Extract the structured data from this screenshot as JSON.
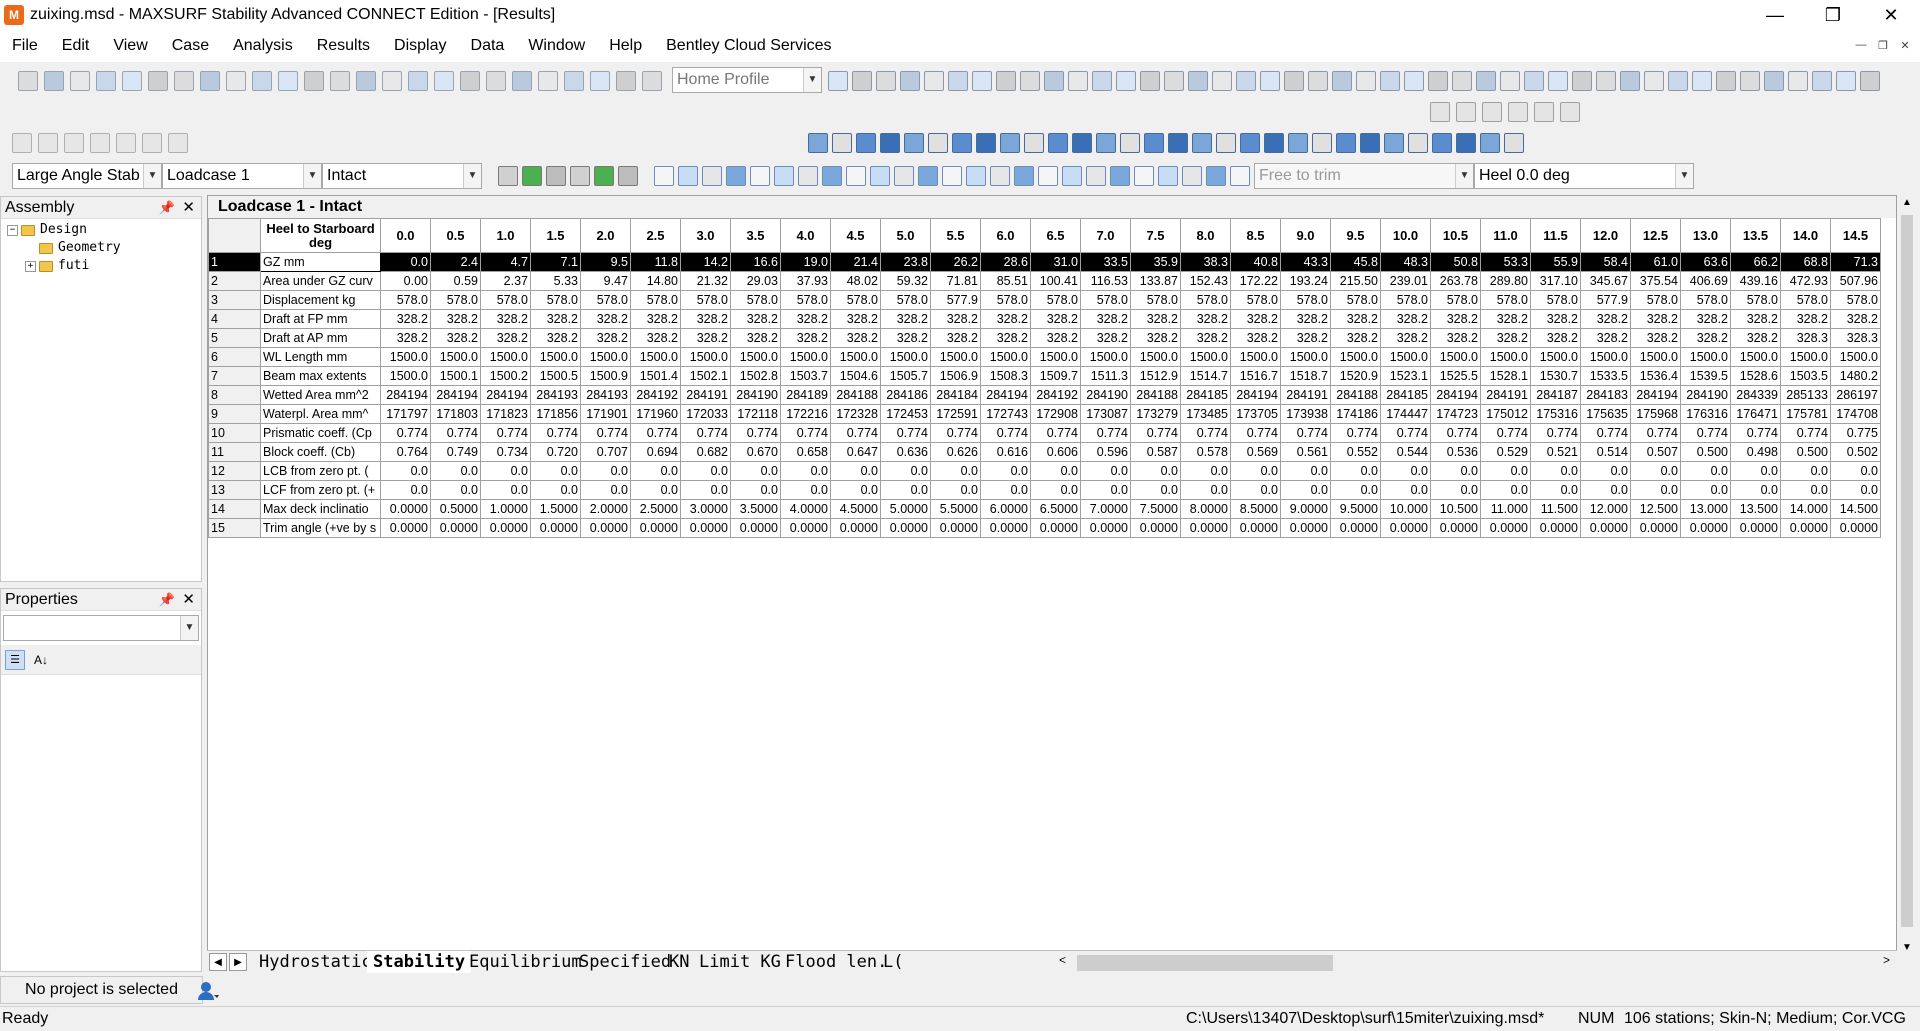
{
  "window": {
    "title": "zuixing.msd - MAXSURF Stability Advanced CONNECT Edition - [Results]",
    "controls": [
      "—",
      "❐",
      "✕"
    ]
  },
  "menu": [
    "File",
    "Edit",
    "View",
    "Case",
    "Analysis",
    "Results",
    "Display",
    "Data",
    "Window",
    "Help",
    "Bentley Cloud Services"
  ],
  "toolbar": {
    "profile_combo": "Home Profile",
    "analysis_combo": "Large Angle Stab",
    "loadcase_combo": "Loadcase 1",
    "damage_combo": "Intact",
    "trim_combo": "Free to trim",
    "heel_combo": "Heel 0.0 deg"
  },
  "assembly_panel": {
    "title": "Assembly",
    "tree": [
      {
        "label": "Design",
        "level": 0,
        "expander": "−"
      },
      {
        "label": "Geometry",
        "level": 1,
        "expander": ""
      },
      {
        "label": "futi",
        "level": 1,
        "expander": "+"
      }
    ]
  },
  "properties_panel": {
    "title": "Properties"
  },
  "results": {
    "title": "Loadcase 1 - Intact",
    "header_label": "Heel to Starboard deg",
    "columns": [
      "0.0",
      "0.5",
      "1.0",
      "1.5",
      "2.0",
      "2.5",
      "3.0",
      "3.5",
      "4.0",
      "4.5",
      "5.0",
      "5.5",
      "6.0",
      "6.5",
      "7.0",
      "7.5",
      "8.0",
      "8.5",
      "9.0",
      "9.5",
      "10.0",
      "10.5",
      "11.0",
      "11.5",
      "12.0",
      "12.5",
      "13.0",
      "13.5",
      "14.0",
      "14.5"
    ],
    "rows": [
      {
        "n": "1",
        "label": "GZ mm",
        "values": [
          "0.0",
          "2.4",
          "4.7",
          "7.1",
          "9.5",
          "11.8",
          "14.2",
          "16.6",
          "19.0",
          "21.4",
          "23.8",
          "26.2",
          "28.6",
          "31.0",
          "33.5",
          "35.9",
          "38.3",
          "40.8",
          "43.3",
          "45.8",
          "48.3",
          "50.8",
          "53.3",
          "55.9",
          "58.4",
          "61.0",
          "63.6",
          "66.2",
          "68.8",
          "71.3"
        ]
      },
      {
        "n": "2",
        "label": "Area under GZ curv",
        "values": [
          "0.00",
          "0.59",
          "2.37",
          "5.33",
          "9.47",
          "14.80",
          "21.32",
          "29.03",
          "37.93",
          "48.02",
          "59.32",
          "71.81",
          "85.51",
          "100.41",
          "116.53",
          "133.87",
          "152.43",
          "172.22",
          "193.24",
          "215.50",
          "239.01",
          "263.78",
          "289.80",
          "317.10",
          "345.67",
          "375.54",
          "406.69",
          "439.16",
          "472.93",
          "507.96"
        ]
      },
      {
        "n": "3",
        "label": "Displacement kg",
        "values": [
          "578.0",
          "578.0",
          "578.0",
          "578.0",
          "578.0",
          "578.0",
          "578.0",
          "578.0",
          "578.0",
          "578.0",
          "578.0",
          "577.9",
          "578.0",
          "578.0",
          "578.0",
          "578.0",
          "578.0",
          "578.0",
          "578.0",
          "578.0",
          "578.0",
          "578.0",
          "578.0",
          "578.0",
          "577.9",
          "578.0",
          "578.0",
          "578.0",
          "578.0",
          "578.0"
        ]
      },
      {
        "n": "4",
        "label": "Draft at FP mm",
        "values": [
          "328.2",
          "328.2",
          "328.2",
          "328.2",
          "328.2",
          "328.2",
          "328.2",
          "328.2",
          "328.2",
          "328.2",
          "328.2",
          "328.2",
          "328.2",
          "328.2",
          "328.2",
          "328.2",
          "328.2",
          "328.2",
          "328.2",
          "328.2",
          "328.2",
          "328.2",
          "328.2",
          "328.2",
          "328.2",
          "328.2",
          "328.2",
          "328.2",
          "328.2",
          "328.2"
        ]
      },
      {
        "n": "5",
        "label": "Draft at AP mm",
        "values": [
          "328.2",
          "328.2",
          "328.2",
          "328.2",
          "328.2",
          "328.2",
          "328.2",
          "328.2",
          "328.2",
          "328.2",
          "328.2",
          "328.2",
          "328.2",
          "328.2",
          "328.2",
          "328.2",
          "328.2",
          "328.2",
          "328.2",
          "328.2",
          "328.2",
          "328.2",
          "328.2",
          "328.2",
          "328.2",
          "328.2",
          "328.2",
          "328.2",
          "328.3",
          "328.3"
        ]
      },
      {
        "n": "6",
        "label": "WL Length mm",
        "values": [
          "1500.0",
          "1500.0",
          "1500.0",
          "1500.0",
          "1500.0",
          "1500.0",
          "1500.0",
          "1500.0",
          "1500.0",
          "1500.0",
          "1500.0",
          "1500.0",
          "1500.0",
          "1500.0",
          "1500.0",
          "1500.0",
          "1500.0",
          "1500.0",
          "1500.0",
          "1500.0",
          "1500.0",
          "1500.0",
          "1500.0",
          "1500.0",
          "1500.0",
          "1500.0",
          "1500.0",
          "1500.0",
          "1500.0",
          "1500.0"
        ]
      },
      {
        "n": "7",
        "label": "Beam max extents",
        "values": [
          "1500.0",
          "1500.1",
          "1500.2",
          "1500.5",
          "1500.9",
          "1501.4",
          "1502.1",
          "1502.8",
          "1503.7",
          "1504.6",
          "1505.7",
          "1506.9",
          "1508.3",
          "1509.7",
          "1511.3",
          "1512.9",
          "1514.7",
          "1516.7",
          "1518.7",
          "1520.9",
          "1523.1",
          "1525.5",
          "1528.1",
          "1530.7",
          "1533.5",
          "1536.4",
          "1539.5",
          "1528.6",
          "1503.5",
          "1480.2"
        ]
      },
      {
        "n": "8",
        "label": "Wetted Area mm^2",
        "values": [
          "284194",
          "284194",
          "284194",
          "284193",
          "284193",
          "284192",
          "284191",
          "284190",
          "284189",
          "284188",
          "284186",
          "284184",
          "284194",
          "284192",
          "284190",
          "284188",
          "284185",
          "284194",
          "284191",
          "284188",
          "284185",
          "284194",
          "284191",
          "284187",
          "284183",
          "284194",
          "284190",
          "284339",
          "285133",
          "286197"
        ]
      },
      {
        "n": "9",
        "label": "Waterpl. Area mm^",
        "values": [
          "171797",
          "171803",
          "171823",
          "171856",
          "171901",
          "171960",
          "172033",
          "172118",
          "172216",
          "172328",
          "172453",
          "172591",
          "172743",
          "172908",
          "173087",
          "173279",
          "173485",
          "173705",
          "173938",
          "174186",
          "174447",
          "174723",
          "175012",
          "175316",
          "175635",
          "175968",
          "176316",
          "176471",
          "175781",
          "174708"
        ]
      },
      {
        "n": "10",
        "label": "Prismatic coeff. (Cp",
        "values": [
          "0.774",
          "0.774",
          "0.774",
          "0.774",
          "0.774",
          "0.774",
          "0.774",
          "0.774",
          "0.774",
          "0.774",
          "0.774",
          "0.774",
          "0.774",
          "0.774",
          "0.774",
          "0.774",
          "0.774",
          "0.774",
          "0.774",
          "0.774",
          "0.774",
          "0.774",
          "0.774",
          "0.774",
          "0.774",
          "0.774",
          "0.774",
          "0.774",
          "0.774",
          "0.775"
        ]
      },
      {
        "n": "11",
        "label": "Block coeff. (Cb)",
        "values": [
          "0.764",
          "0.749",
          "0.734",
          "0.720",
          "0.707",
          "0.694",
          "0.682",
          "0.670",
          "0.658",
          "0.647",
          "0.636",
          "0.626",
          "0.616",
          "0.606",
          "0.596",
          "0.587",
          "0.578",
          "0.569",
          "0.561",
          "0.552",
          "0.544",
          "0.536",
          "0.529",
          "0.521",
          "0.514",
          "0.507",
          "0.500",
          "0.498",
          "0.500",
          "0.502"
        ]
      },
      {
        "n": "12",
        "label": "LCB from zero pt. (",
        "values": [
          "0.0",
          "0.0",
          "0.0",
          "0.0",
          "0.0",
          "0.0",
          "0.0",
          "0.0",
          "0.0",
          "0.0",
          "0.0",
          "0.0",
          "0.0",
          "0.0",
          "0.0",
          "0.0",
          "0.0",
          "0.0",
          "0.0",
          "0.0",
          "0.0",
          "0.0",
          "0.0",
          "0.0",
          "0.0",
          "0.0",
          "0.0",
          "0.0",
          "0.0",
          "0.0"
        ]
      },
      {
        "n": "13",
        "label": "LCF from zero pt. (+",
        "values": [
          "0.0",
          "0.0",
          "0.0",
          "0.0",
          "0.0",
          "0.0",
          "0.0",
          "0.0",
          "0.0",
          "0.0",
          "0.0",
          "0.0",
          "0.0",
          "0.0",
          "0.0",
          "0.0",
          "0.0",
          "0.0",
          "0.0",
          "0.0",
          "0.0",
          "0.0",
          "0.0",
          "0.0",
          "0.0",
          "0.0",
          "0.0",
          "0.0",
          "0.0",
          "0.0"
        ]
      },
      {
        "n": "14",
        "label": "Max deck inclinatio",
        "values": [
          "0.0000",
          "0.5000",
          "1.0000",
          "1.5000",
          "2.0000",
          "2.5000",
          "3.0000",
          "3.5000",
          "4.0000",
          "4.5000",
          "5.0000",
          "5.5000",
          "6.0000",
          "6.5000",
          "7.0000",
          "7.5000",
          "8.0000",
          "8.5000",
          "9.0000",
          "9.5000",
          "10.000",
          "10.500",
          "11.000",
          "11.500",
          "12.000",
          "12.500",
          "13.000",
          "13.500",
          "14.000",
          "14.500"
        ]
      },
      {
        "n": "15",
        "label": "Trim angle (+ve by s",
        "values": [
          "0.0000",
          "0.0000",
          "0.0000",
          "0.0000",
          "0.0000",
          "0.0000",
          "0.0000",
          "0.0000",
          "0.0000",
          "0.0000",
          "0.0000",
          "0.0000",
          "0.0000",
          "0.0000",
          "0.0000",
          "0.0000",
          "0.0000",
          "0.0000",
          "0.0000",
          "0.0000",
          "0.0000",
          "0.0000",
          "0.0000",
          "0.0000",
          "0.0000",
          "0.0000",
          "0.0000",
          "0.0000",
          "0.0000",
          "0.0000"
        ]
      }
    ]
  },
  "sheet_tabs": [
    "Hydrostatics",
    "Stability",
    "Equilibrium",
    "Specified",
    "KN",
    "Limit KG",
    "Flood len.",
    "L("
  ],
  "project_bar": {
    "text": "No project is selected"
  },
  "status": {
    "left": "Ready",
    "path": "C:\\Users\\13407\\Desktop\\surf\\15miter\\zuixing.msd*",
    "num": "NUM",
    "info": "106 stations; Skin-N; Medium; Cor.VCG"
  }
}
